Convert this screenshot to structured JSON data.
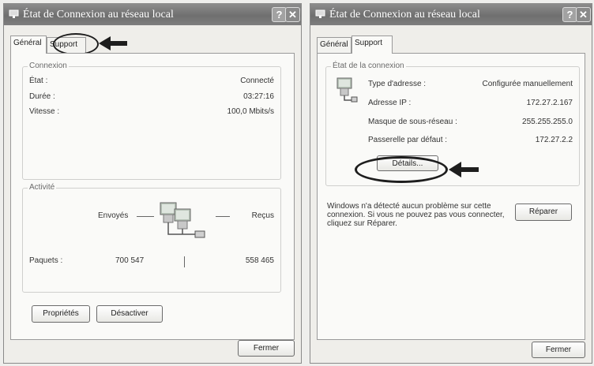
{
  "left_dialog": {
    "title": "État de Connexion au réseau local",
    "tabs": [
      "Général",
      "Support"
    ],
    "connexion": {
      "legend": "Connexion",
      "rows": [
        {
          "label": "État :",
          "value": "Connecté"
        },
        {
          "label": "Durée :",
          "value": "03:27:16"
        },
        {
          "label": "Vitesse :",
          "value": "100,0 Mbits/s"
        }
      ]
    },
    "activite": {
      "legend": "Activité",
      "sent_label": "Envoyés",
      "received_label": "Reçus",
      "packets_label": "Paquets :",
      "sent_value": "700 547",
      "received_value": "558 465"
    },
    "properties_button": "Propriétés",
    "disable_button": "Désactiver",
    "close_button": "Fermer"
  },
  "right_dialog": {
    "title": "État de Connexion au réseau local",
    "tabs": [
      "Général",
      "Support"
    ],
    "etat": {
      "legend": "État de la connexion",
      "rows": [
        {
          "label": "Type d'adresse :",
          "value": "Configurée manuellement"
        },
        {
          "label": "Adresse IP :",
          "value": "172.27.2.167"
        },
        {
          "label": "Masque de sous-réseau :",
          "value": "255.255.255.0"
        },
        {
          "label": "Passerelle par défaut :",
          "value": "172.27.2.2"
        }
      ],
      "details_button": "Détails..."
    },
    "message": "Windows n'a détecté aucun problème sur cette connexion. Si vous ne pouvez pas vous connecter, cliquez sur Réparer.",
    "repair_button": "Réparer",
    "close_button": "Fermer"
  },
  "titlebar_buttons": {
    "help": "?",
    "close": "✕"
  },
  "colors": {
    "titlebar": "#7a7a7a",
    "panel": "#fafaf8",
    "dialog": "#efeeea",
    "annotation": "#1e1e1e"
  }
}
